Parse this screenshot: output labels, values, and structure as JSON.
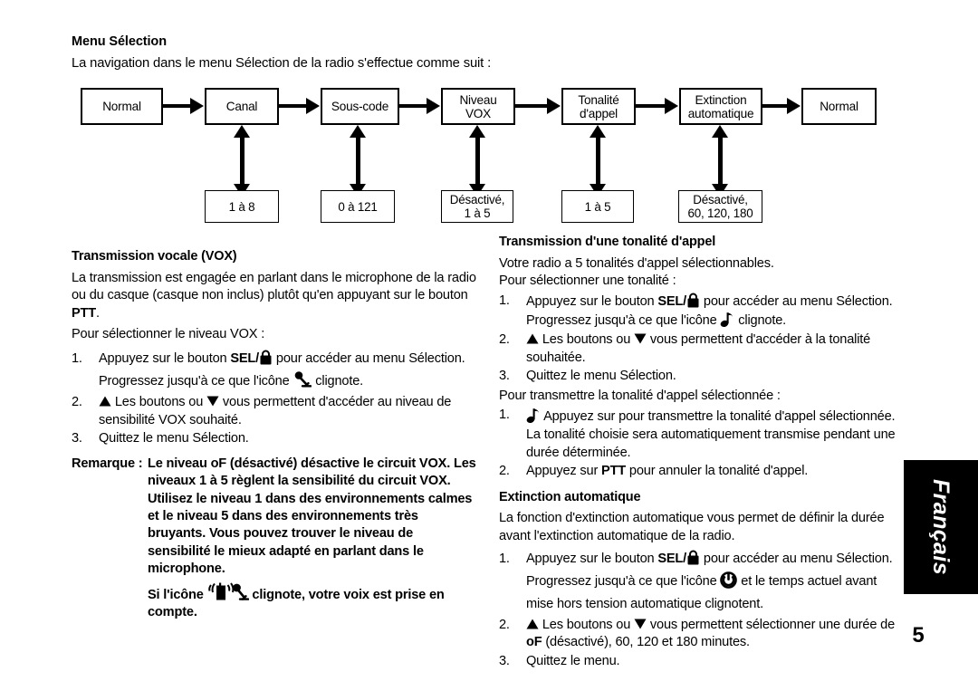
{
  "intro": {
    "heading": "Menu Sélection",
    "text": "La navigation dans le menu Sélection de la radio s'effectue comme suit :"
  },
  "flow": {
    "main_boxes": [
      {
        "lines": [
          "Normal"
        ]
      },
      {
        "lines": [
          "Canal"
        ]
      },
      {
        "lines": [
          "Sous-code"
        ]
      },
      {
        "lines": [
          "Niveau",
          "VOX"
        ]
      },
      {
        "lines": [
          "Tonalité",
          "d'appel"
        ]
      },
      {
        "lines": [
          "Extinction",
          "automatique"
        ]
      },
      {
        "lines": [
          "Normal"
        ]
      }
    ],
    "sub_boxes": [
      {
        "lines": [
          "1 à 8"
        ]
      },
      {
        "lines": [
          "0 à 121"
        ]
      },
      {
        "lines": [
          "Désactivé,",
          "1 à 5"
        ]
      },
      {
        "lines": [
          "1 à 5"
        ]
      },
      {
        "lines": [
          "Désactivé,",
          "60, 120, 180"
        ]
      }
    ]
  },
  "vox": {
    "heading": "Transmission vocale (VOX)",
    "intro_1": "La transmission est engagée en parlant dans le microphone de la radio ou du casque (casque non inclus) plutôt qu'en appuyant sur le bouton ",
    "intro_1_bold": "PTT",
    "intro_1_end": ".",
    "intro_2": "Pour sélectionner le niveau VOX :",
    "step1_a": "Appuyez sur le bouton ",
    "step1_bold": "SEL/",
    "step1_b": " pour accéder au menu Sélection. Progressez jusqu'à ce que l'icône ",
    "step1_c": " clignote.",
    "step2_a": " Les boutons ou ",
    "step2_b": " vous permettent d'accéder au niveau de sensibilité VOX souhaité.",
    "step3": "Quittez le menu Sélection.",
    "numbers": [
      "1.",
      "2.",
      "3."
    ],
    "remark_label": "Remarque :",
    "remark_body": "Le niveau oF (désactivé) désactive le circuit VOX. Les niveaux 1 à 5 règlent la sensibilité du circuit VOX. Utilisez le niveau 1 dans des environnements calmes et le niveau 5 dans des environnements très bruyants. Vous pouvez trouver le niveau de sensibilité le mieux adapté en parlant dans le microphone.",
    "remark_sub_a": "Si l'icône ",
    "remark_sub_b": " clignote, votre voix est prise en compte."
  },
  "tone": {
    "heading": "Transmission d'une tonalité d'appel",
    "intro_1": "Votre radio a 5 tonalités d'appel sélectionnables.",
    "intro_2": "Pour sélectionner une tonalité :",
    "step1_a": "Appuyez sur le bouton ",
    "step1_bold": "SEL/",
    "step1_b": " pour accéder au menu Sélection. Progressez jusqu'à ce que l'icône ",
    "step1_c": " clignote.",
    "step2_a": " Les boutons ou ",
    "step2_b": " vous permettent d'accéder à la tonalité souhaitée.",
    "step3": "Quittez le menu Sélection.",
    "numbers": [
      "1.",
      "2.",
      "3."
    ],
    "transmit_intro": "Pour transmettre la tonalité d'appel sélectionnée :",
    "t_step1_a": " Appuyez sur  pour transmettre la tonalité d'appel sélectionnée. La tonalité choisie sera automatiquement transmise pendant une durée déterminée.",
    "t_step2_a": "Appuyez sur ",
    "t_step2_bold": "PTT",
    "t_step2_b": " pour annuler la tonalité d'appel.",
    "t_numbers": [
      "1.",
      "2."
    ]
  },
  "auto_off": {
    "heading": "Extinction automatique",
    "intro": "La fonction d'extinction automatique vous permet de définir la durée avant l'extinction automatique de la radio.",
    "step1_a": "Appuyez sur le bouton ",
    "step1_bold": "SEL/",
    "step1_b": " pour accéder au menu Sélection. Progressez jusqu'à ce que l'icône ",
    "step1_c": " et le temps actuel avant mise hors tension automatique clignotent.",
    "step2_a": " Les boutons ou ",
    "step2_b": " vous permettent  sélectionner une durée de ",
    "step2_bold": "oF",
    "step2_c": " (désactivé), 60, 120 et 180 minutes.",
    "step3": "Quittez le menu.",
    "numbers": [
      "1.",
      "2.",
      "3."
    ]
  },
  "sidebar": {
    "language_label": "Français",
    "page_number": "5"
  },
  "icons": {
    "lock": "lock-icon",
    "microphone": "microphone-icon",
    "radio_mic": "radio-transmit-microphone-icon",
    "music_note": "music-note-icon",
    "power": "power-icon",
    "up_triangle": "▲",
    "down_triangle": "▼"
  },
  "colors": {
    "ink": "#000000",
    "paper": "#ffffff"
  }
}
